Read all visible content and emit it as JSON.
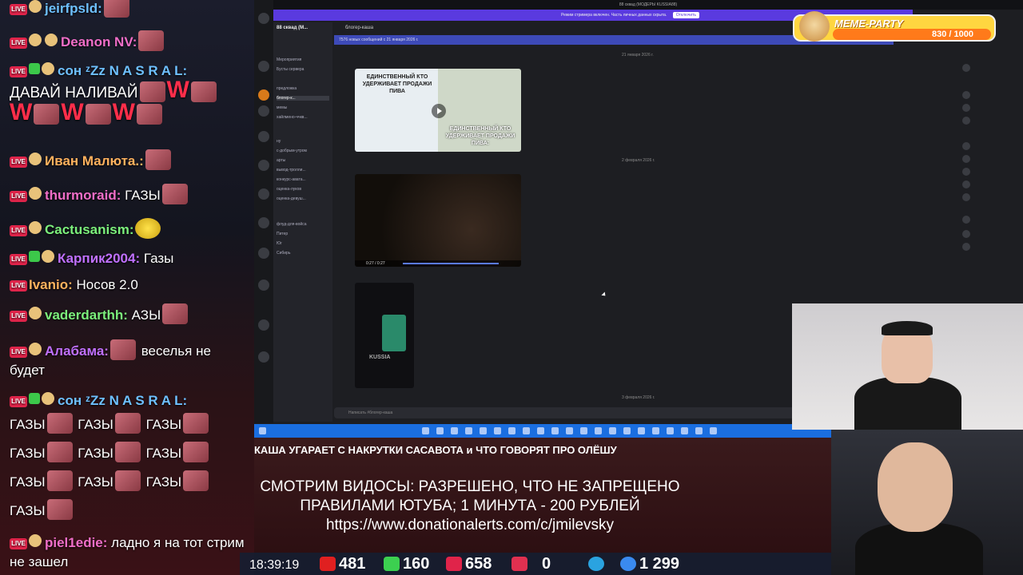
{
  "chat": {
    "messages": [
      {
        "user": "jeirfpsld:",
        "text": ""
      },
      {
        "user": "Deanon NV:",
        "text": ""
      },
      {
        "user": "сон ᶻZz N A S R A L:",
        "text": "ДАВАЙ НАЛИВАЙ"
      },
      {
        "user": "Иван Малюта.:",
        "text": ""
      },
      {
        "user": "thurmoraid:",
        "text": "ГАЗЫ"
      },
      {
        "user": "Cactusanism:",
        "text": ""
      },
      {
        "user": "Карпик2004:",
        "text": "Газы"
      },
      {
        "user": "Ivanio:",
        "text": "Носов 2.0"
      },
      {
        "user": "vaderdarthh:",
        "text": "АЗЫ"
      },
      {
        "user": "Алабама:",
        "text": "веселья не будет"
      },
      {
        "user": "сон ᶻZz N A S R A L:",
        "text": "ГАЗЫ"
      },
      {
        "user": "piel1edie:",
        "text": "ладно я на тот стрим не зашел"
      }
    ],
    "w_letter": "W"
  },
  "screen": {
    "tab_title": "88 сквад (МОДЕРЫ KUSSIA88)",
    "notice_bar": "Режим стримера включен. Часть личных данных скрыта.",
    "notice_button": "Отключить",
    "server_name": "88 сквад (М...",
    "channel_header": "блогер-каша",
    "new_messages": "7576 новых сообщений с 21 января 2026 г.",
    "channels": [
      "Мероприятия",
      "Бусты сервера",
      "предложка",
      "блогер-к...",
      "мемы",
      "хайлмено-ччкв...",
      "ну",
      "с-добрым-утром",
      "арты",
      "вывод-тролли...",
      "конкурс-авата...",
      "оценка-луков",
      "оценка-девуш...",
      "флуд-для-войса",
      "Питер",
      "Юг",
      "Сибирь"
    ],
    "image1_top_text": "ЕДИНСТВЕННЫЙ КТО УДЕРЖИВАЕТ ПРОДАЖИ ПИВА",
    "image1_bottom_text": "ЕДИНСТВЕННЫЙ КТО УДЕРЖИВАЕТ ПРОДАЖИ ПИВА:",
    "video_time": "0:27 / 0:27",
    "tiktok_label": "KUSSIA",
    "input_placeholder": "Написать #блогер-каша",
    "date1": "21 января 2026 г.",
    "date2": "2 февраля 2026 г.",
    "date3": "3 февраля 2026 г."
  },
  "meme_party": {
    "title": "MEME-PARTY",
    "count": "830 / 1000"
  },
  "stream": {
    "title_strip": "КАША УГАРАЕТ С НАКРУТКИ САСАВОТА и ЧТО ГОВОРЯТ ПРО ОЛЁШУ",
    "donate_line1": "СМОТРИМ ВИДОСЫ: РАЗРЕШЕНО, ЧТО НЕ ЗАПРЕЩЕНО",
    "donate_line2": "ПРАВИЛАМИ ЮТУБА; 1 МИНУТА - 200 РУБЛЕЙ",
    "donate_line3": "https://www.donationalerts.com/c/jmilevsky",
    "time": "18:39:19",
    "stats": {
      "youtube": "481",
      "kick": "160",
      "vk": "658",
      "vkplay": "0",
      "rutube": "0",
      "telegram": "",
      "total": "1 299"
    }
  },
  "colors": {
    "accent": "#5a3adf",
    "taskbar": "#1a6ee0",
    "live": "#e0244a",
    "youtube": "#e02020",
    "kick": "#3cd050"
  }
}
